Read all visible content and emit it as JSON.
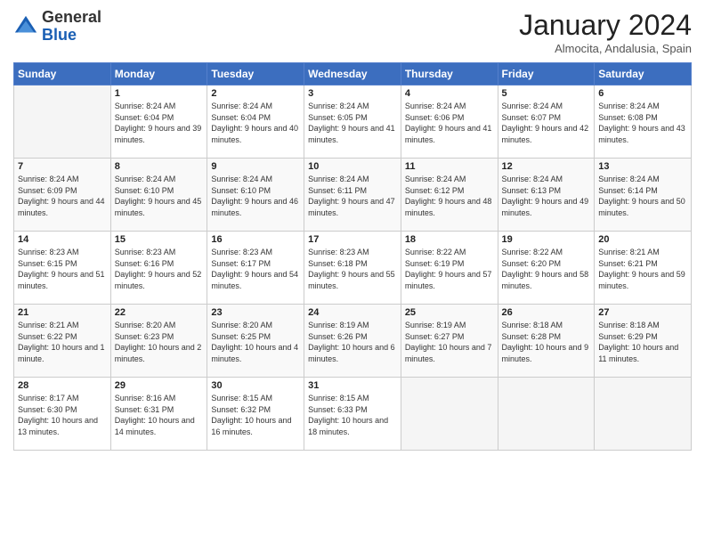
{
  "logo": {
    "line1": "General",
    "line2": "Blue"
  },
  "header": {
    "title": "January 2024",
    "subtitle": "Almocita, Andalusia, Spain"
  },
  "days_of_week": [
    "Sunday",
    "Monday",
    "Tuesday",
    "Wednesday",
    "Thursday",
    "Friday",
    "Saturday"
  ],
  "weeks": [
    [
      {
        "day": "",
        "sunrise": "",
        "sunset": "",
        "daylight": ""
      },
      {
        "day": "1",
        "sunrise": "Sunrise: 8:24 AM",
        "sunset": "Sunset: 6:04 PM",
        "daylight": "Daylight: 9 hours and 39 minutes."
      },
      {
        "day": "2",
        "sunrise": "Sunrise: 8:24 AM",
        "sunset": "Sunset: 6:04 PM",
        "daylight": "Daylight: 9 hours and 40 minutes."
      },
      {
        "day": "3",
        "sunrise": "Sunrise: 8:24 AM",
        "sunset": "Sunset: 6:05 PM",
        "daylight": "Daylight: 9 hours and 41 minutes."
      },
      {
        "day": "4",
        "sunrise": "Sunrise: 8:24 AM",
        "sunset": "Sunset: 6:06 PM",
        "daylight": "Daylight: 9 hours and 41 minutes."
      },
      {
        "day": "5",
        "sunrise": "Sunrise: 8:24 AM",
        "sunset": "Sunset: 6:07 PM",
        "daylight": "Daylight: 9 hours and 42 minutes."
      },
      {
        "day": "6",
        "sunrise": "Sunrise: 8:24 AM",
        "sunset": "Sunset: 6:08 PM",
        "daylight": "Daylight: 9 hours and 43 minutes."
      }
    ],
    [
      {
        "day": "7",
        "sunrise": "Sunrise: 8:24 AM",
        "sunset": "Sunset: 6:09 PM",
        "daylight": "Daylight: 9 hours and 44 minutes."
      },
      {
        "day": "8",
        "sunrise": "Sunrise: 8:24 AM",
        "sunset": "Sunset: 6:10 PM",
        "daylight": "Daylight: 9 hours and 45 minutes."
      },
      {
        "day": "9",
        "sunrise": "Sunrise: 8:24 AM",
        "sunset": "Sunset: 6:10 PM",
        "daylight": "Daylight: 9 hours and 46 minutes."
      },
      {
        "day": "10",
        "sunrise": "Sunrise: 8:24 AM",
        "sunset": "Sunset: 6:11 PM",
        "daylight": "Daylight: 9 hours and 47 minutes."
      },
      {
        "day": "11",
        "sunrise": "Sunrise: 8:24 AM",
        "sunset": "Sunset: 6:12 PM",
        "daylight": "Daylight: 9 hours and 48 minutes."
      },
      {
        "day": "12",
        "sunrise": "Sunrise: 8:24 AM",
        "sunset": "Sunset: 6:13 PM",
        "daylight": "Daylight: 9 hours and 49 minutes."
      },
      {
        "day": "13",
        "sunrise": "Sunrise: 8:24 AM",
        "sunset": "Sunset: 6:14 PM",
        "daylight": "Daylight: 9 hours and 50 minutes."
      }
    ],
    [
      {
        "day": "14",
        "sunrise": "Sunrise: 8:23 AM",
        "sunset": "Sunset: 6:15 PM",
        "daylight": "Daylight: 9 hours and 51 minutes."
      },
      {
        "day": "15",
        "sunrise": "Sunrise: 8:23 AM",
        "sunset": "Sunset: 6:16 PM",
        "daylight": "Daylight: 9 hours and 52 minutes."
      },
      {
        "day": "16",
        "sunrise": "Sunrise: 8:23 AM",
        "sunset": "Sunset: 6:17 PM",
        "daylight": "Daylight: 9 hours and 54 minutes."
      },
      {
        "day": "17",
        "sunrise": "Sunrise: 8:23 AM",
        "sunset": "Sunset: 6:18 PM",
        "daylight": "Daylight: 9 hours and 55 minutes."
      },
      {
        "day": "18",
        "sunrise": "Sunrise: 8:22 AM",
        "sunset": "Sunset: 6:19 PM",
        "daylight": "Daylight: 9 hours and 57 minutes."
      },
      {
        "day": "19",
        "sunrise": "Sunrise: 8:22 AM",
        "sunset": "Sunset: 6:20 PM",
        "daylight": "Daylight: 9 hours and 58 minutes."
      },
      {
        "day": "20",
        "sunrise": "Sunrise: 8:21 AM",
        "sunset": "Sunset: 6:21 PM",
        "daylight": "Daylight: 9 hours and 59 minutes."
      }
    ],
    [
      {
        "day": "21",
        "sunrise": "Sunrise: 8:21 AM",
        "sunset": "Sunset: 6:22 PM",
        "daylight": "Daylight: 10 hours and 1 minute."
      },
      {
        "day": "22",
        "sunrise": "Sunrise: 8:20 AM",
        "sunset": "Sunset: 6:23 PM",
        "daylight": "Daylight: 10 hours and 2 minutes."
      },
      {
        "day": "23",
        "sunrise": "Sunrise: 8:20 AM",
        "sunset": "Sunset: 6:25 PM",
        "daylight": "Daylight: 10 hours and 4 minutes."
      },
      {
        "day": "24",
        "sunrise": "Sunrise: 8:19 AM",
        "sunset": "Sunset: 6:26 PM",
        "daylight": "Daylight: 10 hours and 6 minutes."
      },
      {
        "day": "25",
        "sunrise": "Sunrise: 8:19 AM",
        "sunset": "Sunset: 6:27 PM",
        "daylight": "Daylight: 10 hours and 7 minutes."
      },
      {
        "day": "26",
        "sunrise": "Sunrise: 8:18 AM",
        "sunset": "Sunset: 6:28 PM",
        "daylight": "Daylight: 10 hours and 9 minutes."
      },
      {
        "day": "27",
        "sunrise": "Sunrise: 8:18 AM",
        "sunset": "Sunset: 6:29 PM",
        "daylight": "Daylight: 10 hours and 11 minutes."
      }
    ],
    [
      {
        "day": "28",
        "sunrise": "Sunrise: 8:17 AM",
        "sunset": "Sunset: 6:30 PM",
        "daylight": "Daylight: 10 hours and 13 minutes."
      },
      {
        "day": "29",
        "sunrise": "Sunrise: 8:16 AM",
        "sunset": "Sunset: 6:31 PM",
        "daylight": "Daylight: 10 hours and 14 minutes."
      },
      {
        "day": "30",
        "sunrise": "Sunrise: 8:15 AM",
        "sunset": "Sunset: 6:32 PM",
        "daylight": "Daylight: 10 hours and 16 minutes."
      },
      {
        "day": "31",
        "sunrise": "Sunrise: 8:15 AM",
        "sunset": "Sunset: 6:33 PM",
        "daylight": "Daylight: 10 hours and 18 minutes."
      },
      {
        "day": "",
        "sunrise": "",
        "sunset": "",
        "daylight": ""
      },
      {
        "day": "",
        "sunrise": "",
        "sunset": "",
        "daylight": ""
      },
      {
        "day": "",
        "sunrise": "",
        "sunset": "",
        "daylight": ""
      }
    ]
  ]
}
